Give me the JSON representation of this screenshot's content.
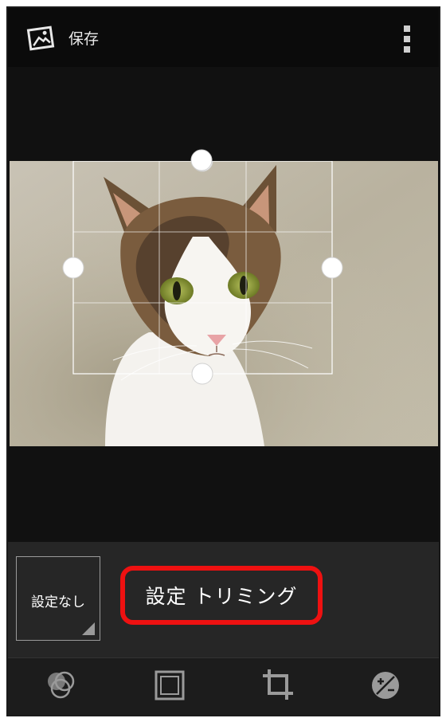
{
  "header": {
    "save_label": "保存",
    "save_icon": "picture-icon",
    "menu_icon": "overflow-menu-icon"
  },
  "editor": {
    "photo_subject": "cat",
    "crop_grid": "3x3"
  },
  "presets": {
    "none_label": "設定なし"
  },
  "callout": {
    "text": "設定 トリミング",
    "border_color": "#ee1111"
  },
  "toolbar": {
    "tools": [
      "filter-effects-icon",
      "frame-icon",
      "crop-icon",
      "exposure-icon"
    ]
  }
}
